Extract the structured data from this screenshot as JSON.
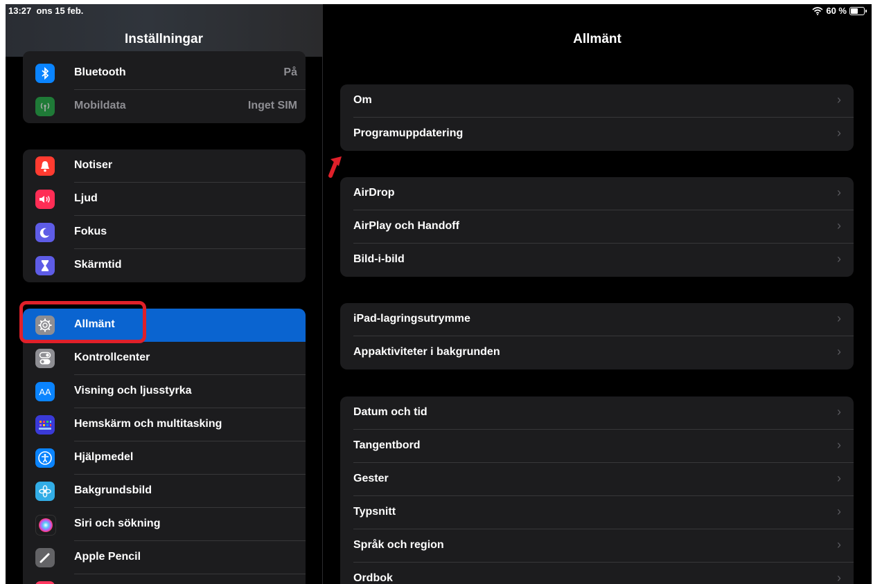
{
  "status_bar": {
    "time": "13:27",
    "date": "ons 15 feb.",
    "wifi": "wifi-icon",
    "battery_text": "60 %",
    "battery_level": 0.6
  },
  "sidebar": {
    "title": "Inställningar",
    "groups": [
      {
        "items": [
          {
            "label": "Bluetooth",
            "value": "På",
            "icon": "bluetooth-icon",
            "color": "#0a84ff"
          },
          {
            "label": "Mobildata",
            "value": "Inget SIM",
            "icon": "antenna-icon",
            "color": "#30d158",
            "dimmed": true
          }
        ]
      },
      {
        "items": [
          {
            "label": "Notiser",
            "icon": "bell-icon",
            "color": "#ff3b30"
          },
          {
            "label": "Ljud",
            "icon": "speaker-icon",
            "color": "#ff2d55"
          },
          {
            "label": "Fokus",
            "icon": "moon-icon",
            "color": "#5e5ce6"
          },
          {
            "label": "Skärmtid",
            "icon": "hourglass-icon",
            "color": "#5e5ce6"
          }
        ]
      },
      {
        "items": [
          {
            "label": "Allmänt",
            "icon": "gear-icon",
            "color": "#8e8e93",
            "selected": true
          },
          {
            "label": "Kontrollcenter",
            "icon": "toggle-icon",
            "color": "#8e8e93"
          },
          {
            "label": "Visning och ljusstyrka",
            "icon": "text-size-icon",
            "color": "#0a84ff",
            "glyph": "AA"
          },
          {
            "label": "Hemskärm och multitasking",
            "icon": "grid-icon",
            "color": "#3a3ad8"
          },
          {
            "label": "Hjälpmedel",
            "icon": "accessibility-icon",
            "color": "#0a84ff"
          },
          {
            "label": "Bakgrundsbild",
            "icon": "flower-icon",
            "color": "#32ade6"
          },
          {
            "label": "Siri och sökning",
            "icon": "siri-icon",
            "color": "#1c1c1e"
          },
          {
            "label": "Apple Pencil",
            "icon": "pencil-icon",
            "color": "#636366"
          },
          {
            "label": "",
            "icon": "fingerprint-icon",
            "color": "#ff375f"
          }
        ]
      }
    ]
  },
  "main": {
    "title": "Allmänt",
    "groups": [
      {
        "items": [
          "Om",
          "Programuppdatering"
        ]
      },
      {
        "items": [
          "AirDrop",
          "AirPlay och Handoff",
          "Bild-i-bild"
        ]
      },
      {
        "items": [
          "iPad-lagringsutrymme",
          "Appaktiviteter i bakgrunden"
        ]
      },
      {
        "items": [
          "Datum och tid",
          "Tangentbord",
          "Gester",
          "Typsnitt",
          "Språk och region",
          "Ordbok"
        ]
      }
    ]
  },
  "annotations": {
    "color": "#e0202a"
  }
}
